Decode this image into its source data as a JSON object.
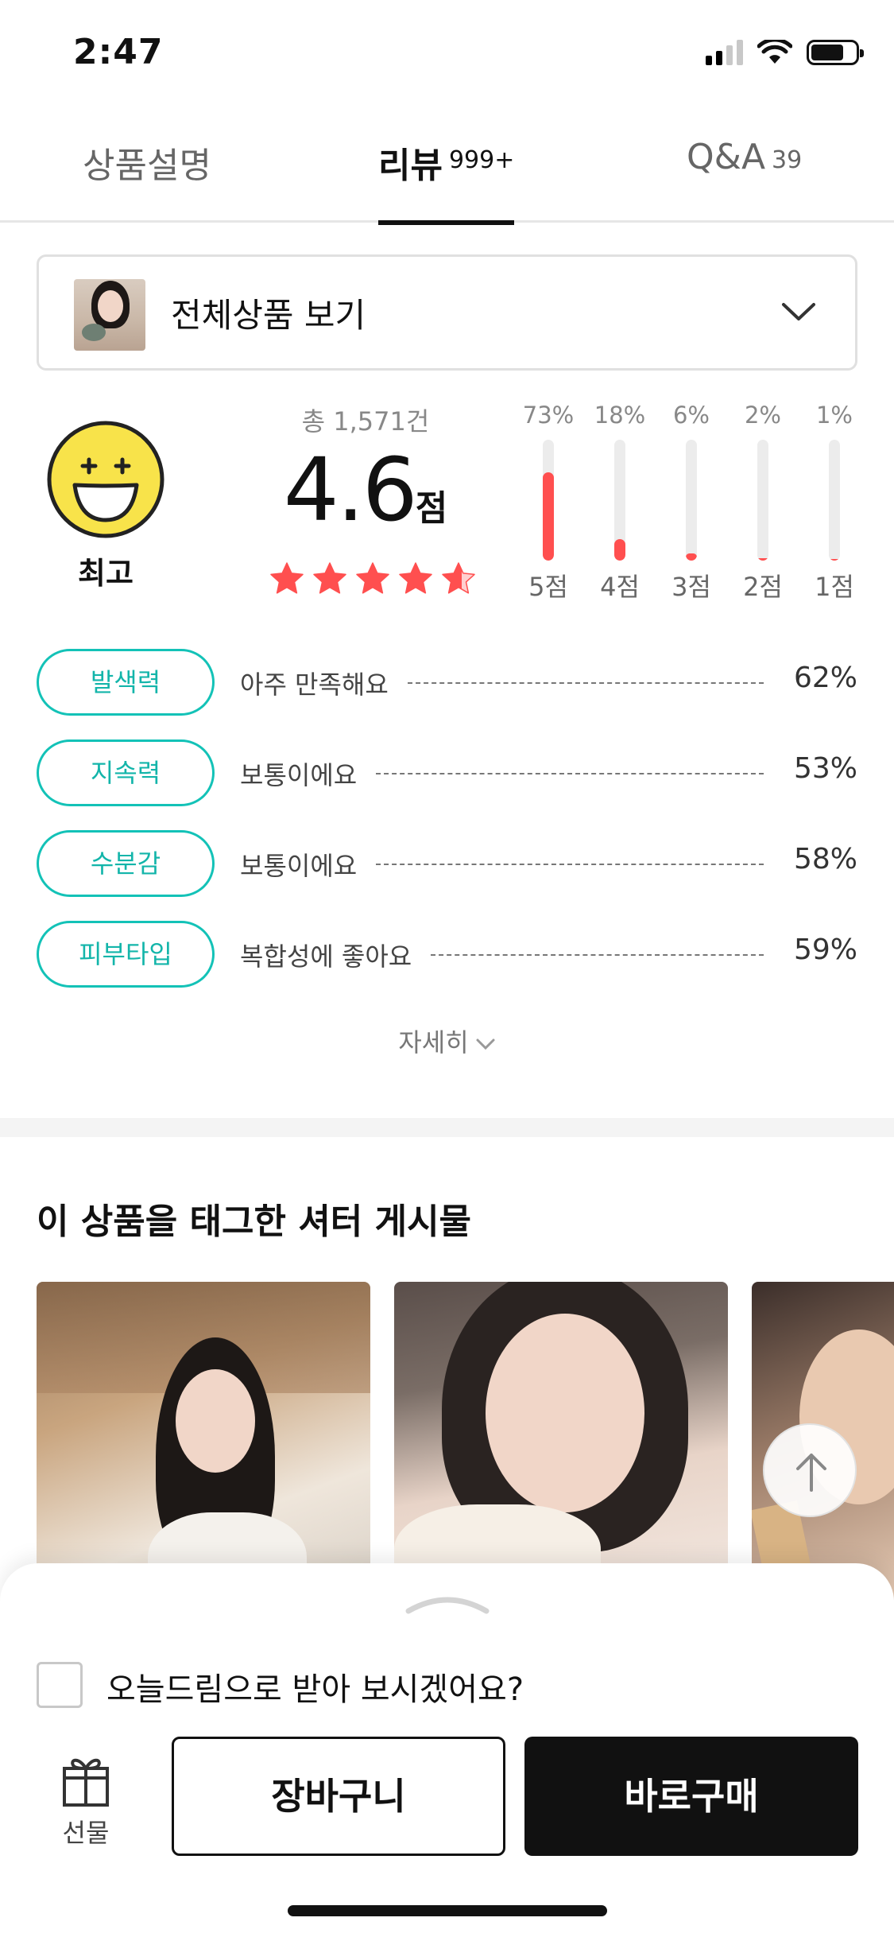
{
  "status_bar": {
    "time": "2:47"
  },
  "tabs": [
    {
      "label": "상품설명",
      "count": ""
    },
    {
      "label": "리뷰",
      "count": "999+"
    },
    {
      "label": "Q&A",
      "count": "39"
    }
  ],
  "selector": {
    "label": "전체상품 보기"
  },
  "rating": {
    "face_label": "최고",
    "total": "총 1,571건",
    "score": "4.6",
    "score_unit": "점",
    "stars_value": 4.6,
    "distribution": [
      {
        "pct_label": "73%",
        "pct": 73,
        "label": "5점"
      },
      {
        "pct_label": "18%",
        "pct": 18,
        "label": "4점"
      },
      {
        "pct_label": "6%",
        "pct": 6,
        "label": "3점"
      },
      {
        "pct_label": "2%",
        "pct": 2,
        "label": "2점"
      },
      {
        "pct_label": "1%",
        "pct": 1,
        "label": "1점"
      }
    ],
    "accent_color": "#ff4f4f"
  },
  "attributes": [
    {
      "name": "발색력",
      "value": "아주 만족해요",
      "pct": "62%"
    },
    {
      "name": "지속력",
      "value": "보통이에요",
      "pct": "53%"
    },
    {
      "name": "수분감",
      "value": "보통이에요",
      "pct": "58%"
    },
    {
      "name": "피부타입",
      "value": "복합성에 좋아요",
      "pct": "59%"
    }
  ],
  "more_label": "자세히",
  "shutter": {
    "title": "이 상품을 태그한 셔터 게시물"
  },
  "bottom_sheet": {
    "today_label": "오늘드림으로 받아 보시겠어요?",
    "gift_label": "선물",
    "cart_label": "장바구니",
    "buy_label": "바로구매"
  },
  "colors": {
    "teal": "#13c2b7",
    "dark": "#111111"
  }
}
